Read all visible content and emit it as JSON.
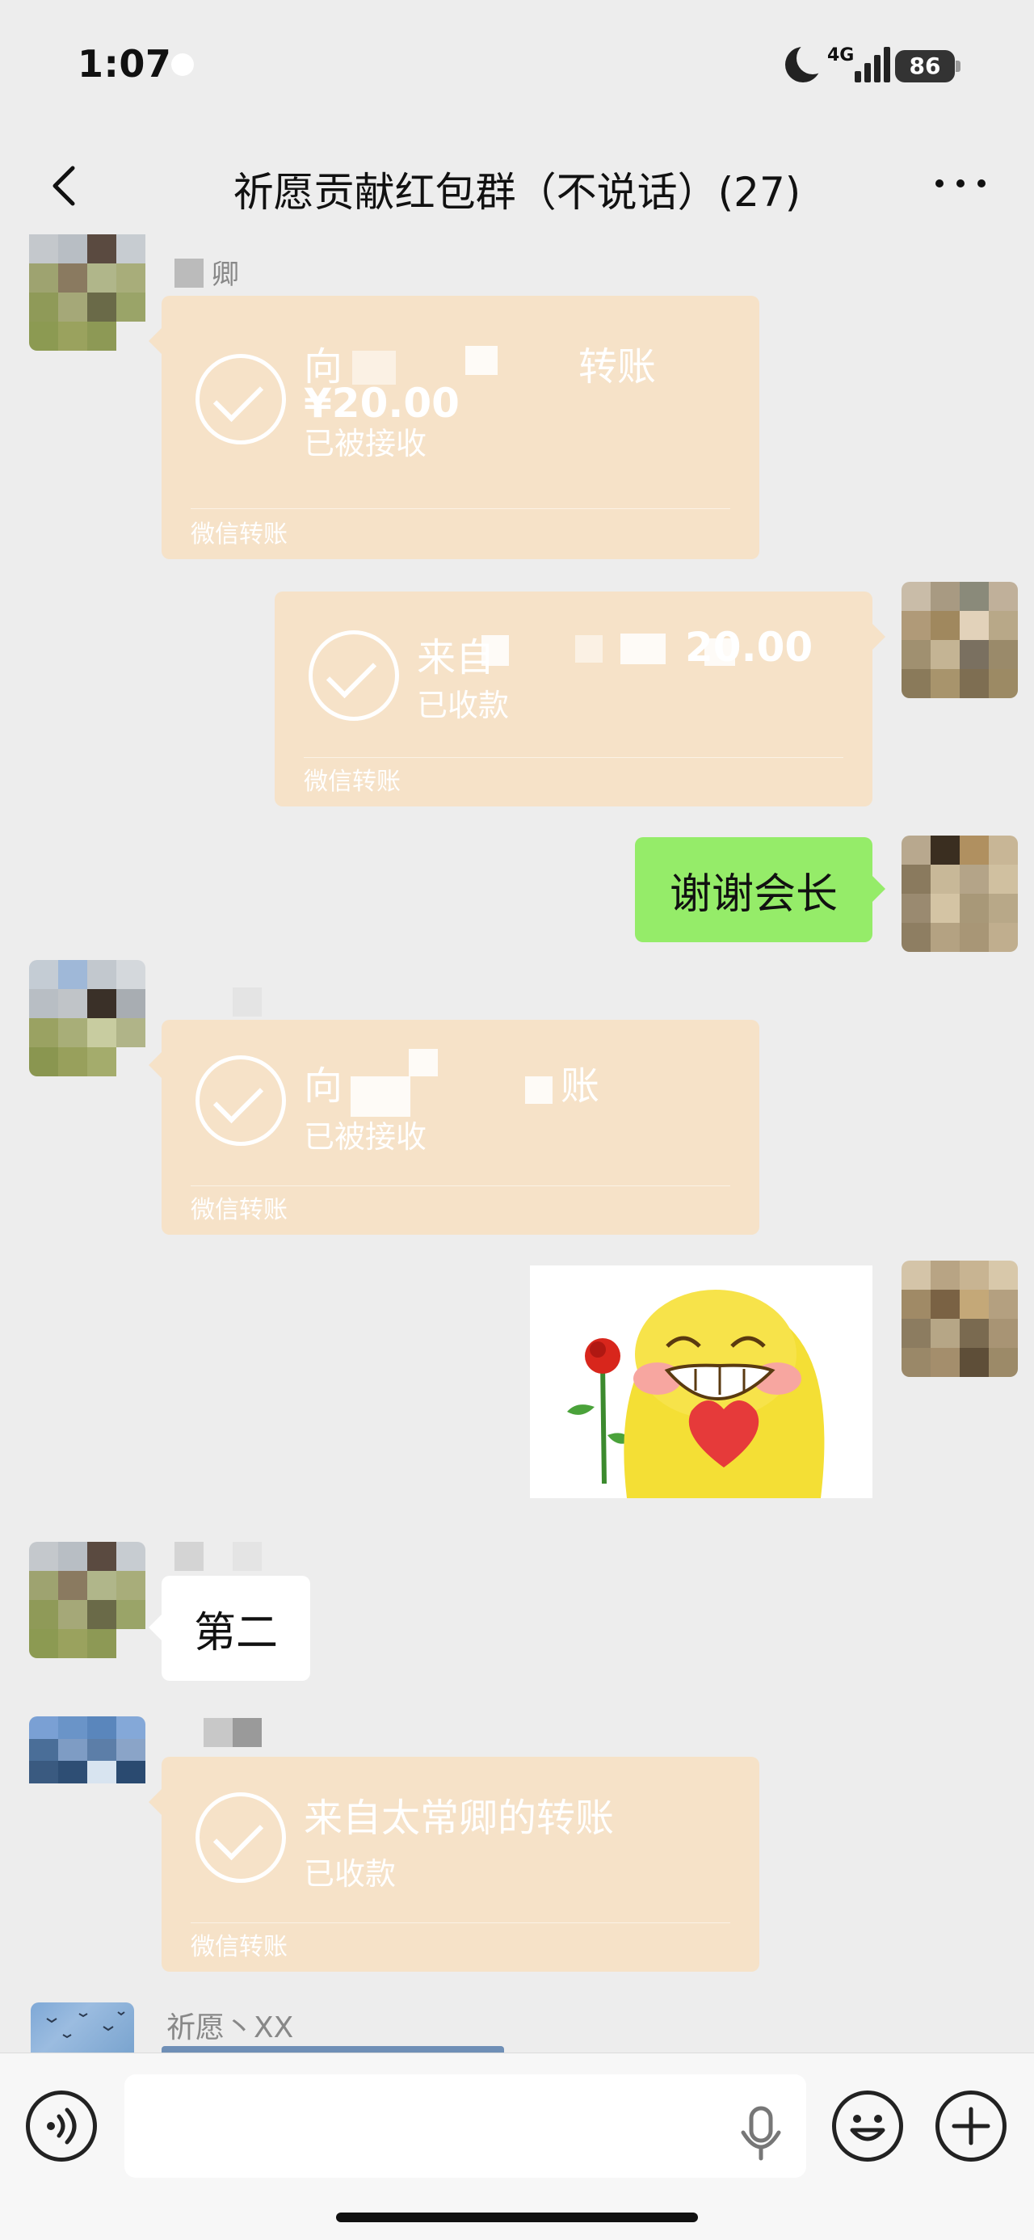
{
  "status_bar": {
    "time": "1:07",
    "network": "4G",
    "battery": "86"
  },
  "header": {
    "title": "祈愿贡献红包群（不说话）(27)",
    "back_icon": "chevron-left-icon",
    "more_icon": "ellipsis-icon"
  },
  "messages": [
    {
      "side": "left",
      "sender": "卿",
      "kind": "transfer",
      "title_start": "向",
      "title_end": "转账",
      "amount": "¥20.00",
      "status": "已被接收",
      "footer": "微信转账"
    },
    {
      "side": "right",
      "kind": "transfer",
      "title_start": "来自",
      "amount": "¥20.00",
      "amount_tail": "20.00",
      "status": "已收款",
      "footer": "微信转账"
    },
    {
      "side": "right",
      "kind": "text",
      "text": "谢谢会长"
    },
    {
      "side": "left",
      "kind": "transfer",
      "title_start": "向",
      "title_end": "账",
      "status": "已被接收",
      "footer": "微信转账"
    },
    {
      "side": "right",
      "kind": "sticker",
      "sticker": "emoji-rose-heart-sticker"
    },
    {
      "side": "left",
      "kind": "text",
      "text": "第二"
    },
    {
      "side": "left",
      "kind": "transfer",
      "title": "来自太常卿的转账",
      "status": "已收款",
      "footer": "微信转账"
    },
    {
      "side": "left",
      "kind": "partial",
      "sender": "祈愿丶XX"
    }
  ],
  "input_bar": {
    "voice_icon": "voice-icon",
    "mic_icon": "microphone-icon",
    "emoji_icon": "smiley-icon",
    "plus_icon": "plus-icon",
    "value": ""
  },
  "colors": {
    "background": "#ededed",
    "transfer": "#f6e2c8",
    "self_bubble": "#95ec69",
    "other_bubble": "#ffffff"
  }
}
